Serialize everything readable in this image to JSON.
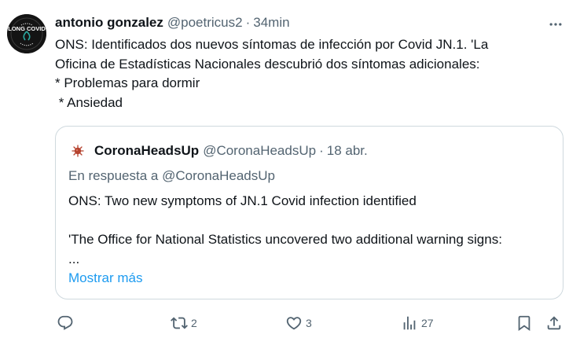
{
  "tweet": {
    "author": {
      "name": "antonio gonzalez",
      "handle": "@poetricus2",
      "time": "34min",
      "avatar_text": "LONG COVID",
      "avatar_ring_text": "AWARENESS"
    },
    "text_lines": [
      "ONS: Identificados dos nuevos síntomas de infección por Covid JN.1. 'La",
      "Oficina de Estadísticas Nacionales descubrió dos síntomas adicionales:",
      "* Problemas para dormir",
      " * Ansiedad"
    ],
    "quote": {
      "name": "CoronaHeadsUp",
      "handle": "@CoronaHeadsUp",
      "time": "18 abr.",
      "reply_prefix": "En respuesta a",
      "reply_handle": "@CoronaHeadsUp",
      "text_lines": [
        "ONS: Two new symptoms of JN.1 Covid infection identified",
        "",
        "'The Office for National Statistics uncovered two additional warning signs:",
        "..."
      ],
      "show_more": "Mostrar más"
    },
    "actions": {
      "reply": {
        "icon": "reply-icon",
        "count": ""
      },
      "retweet": {
        "icon": "retweet-icon",
        "count": "2"
      },
      "like": {
        "icon": "heart-icon",
        "count": "3"
      },
      "views": {
        "icon": "views-icon",
        "count": "27"
      },
      "bookmark": {
        "icon": "bookmark-icon"
      },
      "share": {
        "icon": "share-icon"
      }
    }
  },
  "colors": {
    "text": "#0f1419",
    "secondary": "#536471",
    "link": "#1d9bf0",
    "border": "#cfd9de",
    "virus": "#b5432f"
  }
}
